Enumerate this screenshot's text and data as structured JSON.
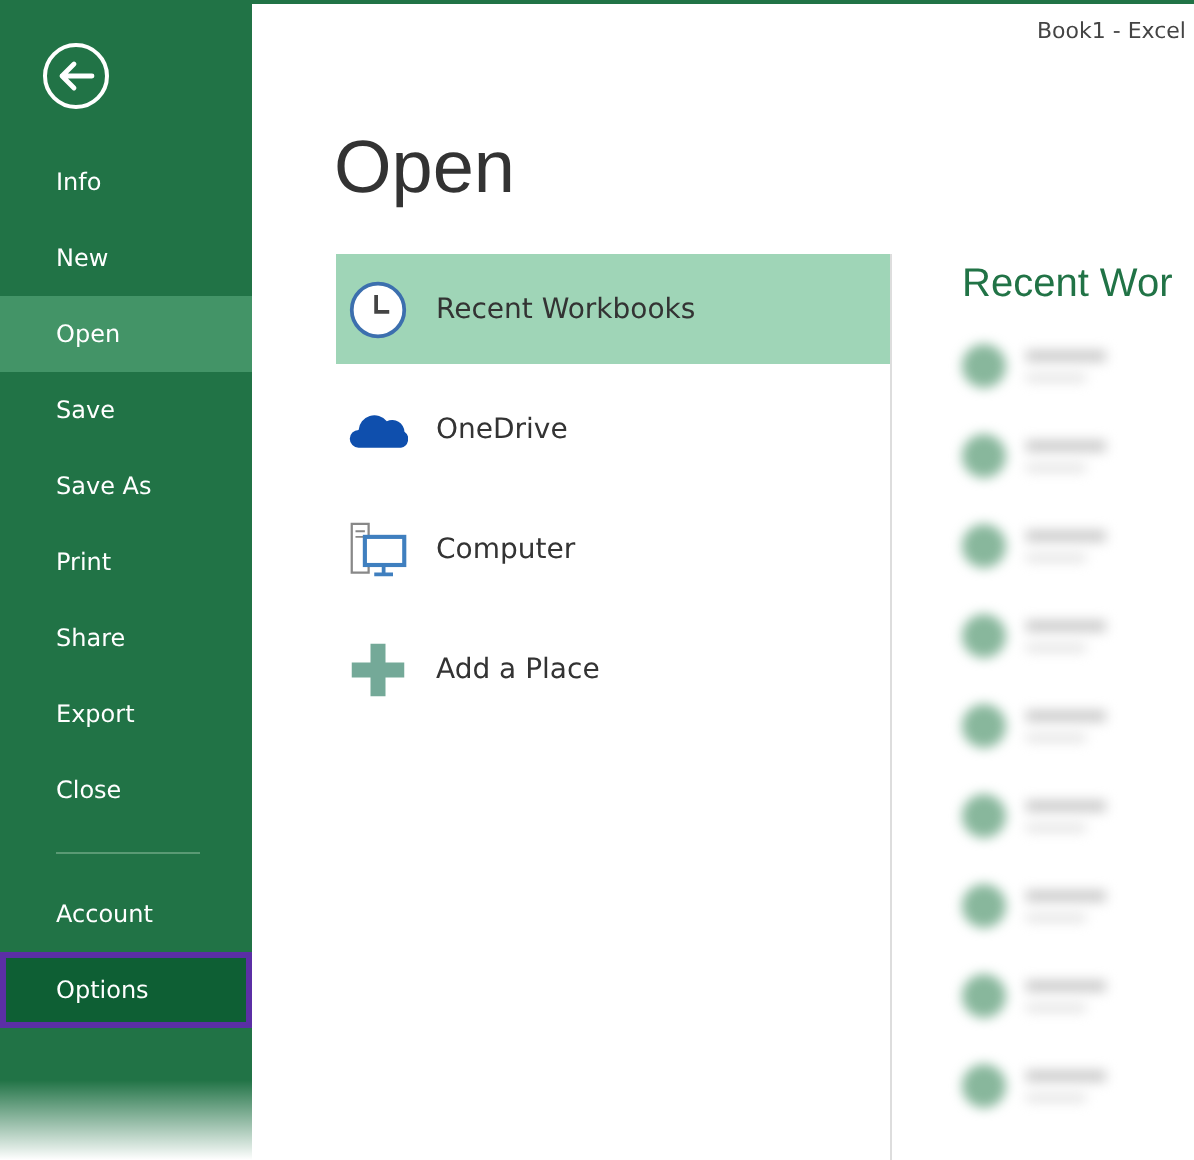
{
  "window": {
    "title": "Book1 - Excel"
  },
  "sidebar": {
    "items": [
      {
        "label": "Info",
        "selected": false,
        "highlighted": false
      },
      {
        "label": "New",
        "selected": false,
        "highlighted": false
      },
      {
        "label": "Open",
        "selected": true,
        "highlighted": false
      },
      {
        "label": "Save",
        "selected": false,
        "highlighted": false
      },
      {
        "label": "Save As",
        "selected": false,
        "highlighted": false
      },
      {
        "label": "Print",
        "selected": false,
        "highlighted": false
      },
      {
        "label": "Share",
        "selected": false,
        "highlighted": false
      },
      {
        "label": "Export",
        "selected": false,
        "highlighted": false
      },
      {
        "label": "Close",
        "selected": false,
        "highlighted": false
      }
    ],
    "footer_items": [
      {
        "label": "Account",
        "selected": false,
        "highlighted": false
      },
      {
        "label": "Options",
        "selected": false,
        "highlighted": true
      }
    ]
  },
  "page_title": "Open",
  "places": [
    {
      "label": "Recent Workbooks",
      "kind": "clock",
      "selected": true
    },
    {
      "label": "OneDrive",
      "kind": "cloud",
      "selected": false
    },
    {
      "label": "Computer",
      "kind": "computer",
      "selected": false
    },
    {
      "label": "Add a Place",
      "kind": "plus",
      "selected": false
    }
  ],
  "recent": {
    "heading": "Recent Wor"
  }
}
